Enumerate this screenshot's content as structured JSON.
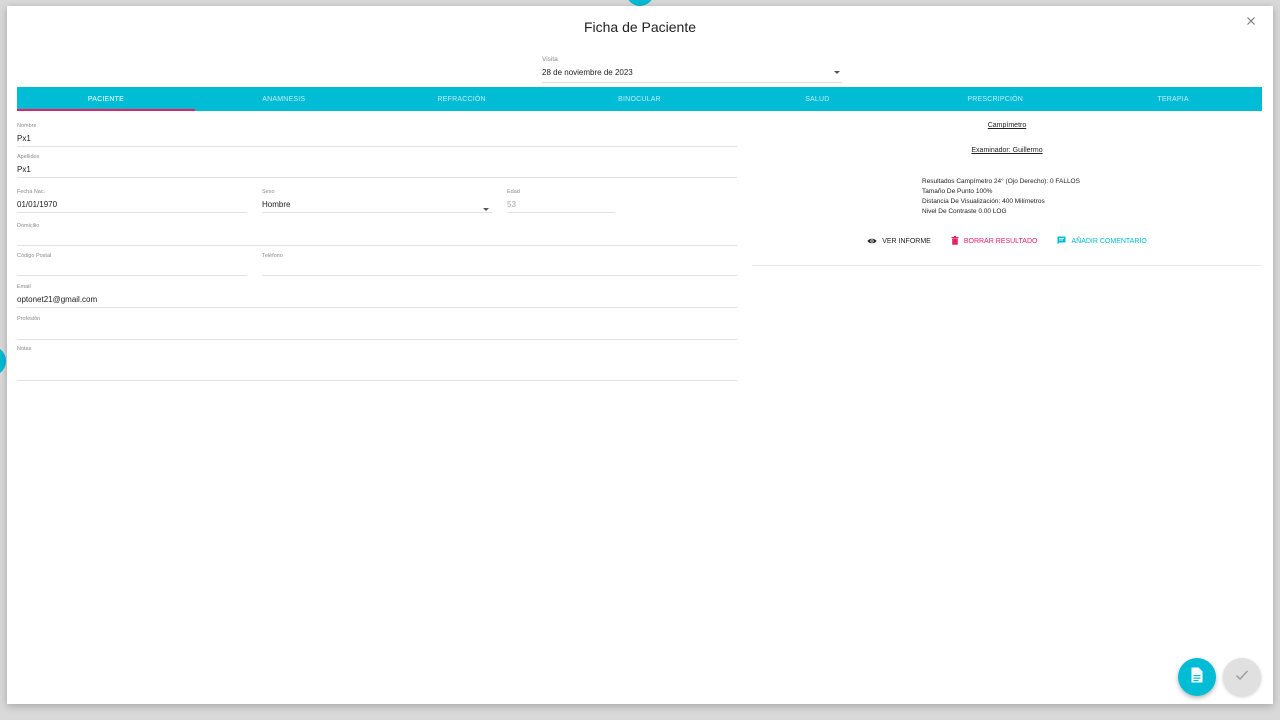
{
  "dialog": {
    "title": "Ficha de Paciente"
  },
  "visit": {
    "label": "Visita",
    "value": "28 de noviembre de 2023"
  },
  "tabs": [
    {
      "label": "PACIENTE",
      "active": true
    },
    {
      "label": "ANAMNESIS"
    },
    {
      "label": "REFRACCIÓN"
    },
    {
      "label": "BINOCULAR"
    },
    {
      "label": "SALUD"
    },
    {
      "label": "PRESCRIPCIÓN"
    },
    {
      "label": "TERAPIA"
    }
  ],
  "form": {
    "nombre": {
      "label": "Nombre",
      "value": "Px1"
    },
    "apellidos": {
      "label": "Apellidos",
      "value": "Px1"
    },
    "fecha_nac": {
      "label": "Fecha Nac.",
      "value": "01/01/1970"
    },
    "sexo": {
      "label": "Sexo",
      "value": "Hombre"
    },
    "edad": {
      "label": "Edad",
      "value": "53"
    },
    "domicilio": {
      "label": "Domicilio",
      "value": ""
    },
    "codigo_postal": {
      "label": "Código Postal",
      "value": ""
    },
    "telefono": {
      "label": "Teléfono",
      "value": ""
    },
    "email": {
      "label": "Email",
      "value": "optonet21@gmail.com"
    },
    "profesion": {
      "label": "Profesión",
      "value": ""
    },
    "notas": {
      "label": "Notas",
      "value": ""
    }
  },
  "result": {
    "title": "Campímetro",
    "examiner": "Examinador: Guillermo",
    "lines": [
      "Resultados Campímetro 24° (Ojo Derecho): 0 FALLOS",
      "Tamaño De Punto 100%",
      "Distancia De Visualización: 400 Milímetros",
      "Nivel De Contraste 0.00 LOG"
    ],
    "actions": {
      "view": "VER INFORME",
      "delete": "BORRAR RESULTADO",
      "comment": "AÑADIR COMENTARIO"
    }
  },
  "colors": {
    "accent": "#00bcd4",
    "danger": "#e91e63"
  },
  "icons": {
    "close": "close-icon",
    "dropdown": "chevron-down-icon",
    "view": "eye-icon",
    "delete": "trash-icon",
    "comment": "comment-icon",
    "doc": "document-icon",
    "check": "check-icon"
  }
}
